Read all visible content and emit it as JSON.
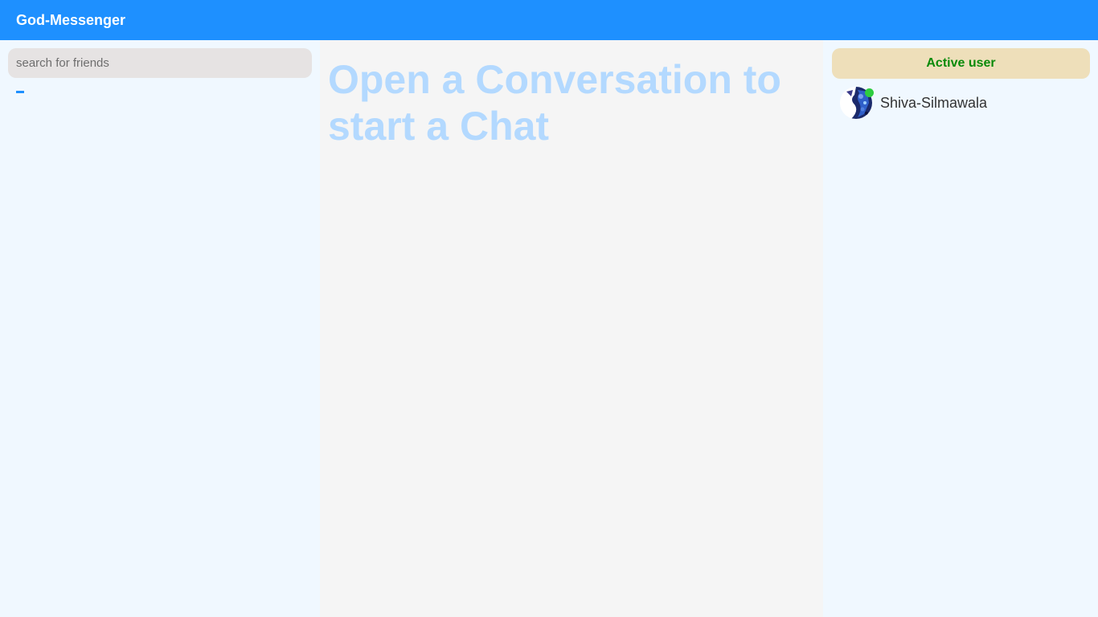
{
  "header": {
    "app_title": "God-Messenger",
    "background_color": "#1e90ff"
  },
  "sidebar": {
    "search": {
      "placeholder": "search for friends",
      "value": ""
    }
  },
  "main": {
    "empty_state_heading": "Open a Conversation to start a Chat",
    "heading_color": "#b3d9ff"
  },
  "active_panel": {
    "title": "Active user",
    "title_color": "#0a8a0a",
    "users": [
      {
        "name": "Shiva-Silmawala",
        "avatar_icon": "user-avatar-icon",
        "status": "online",
        "status_color": "#2ecc40"
      }
    ]
  }
}
